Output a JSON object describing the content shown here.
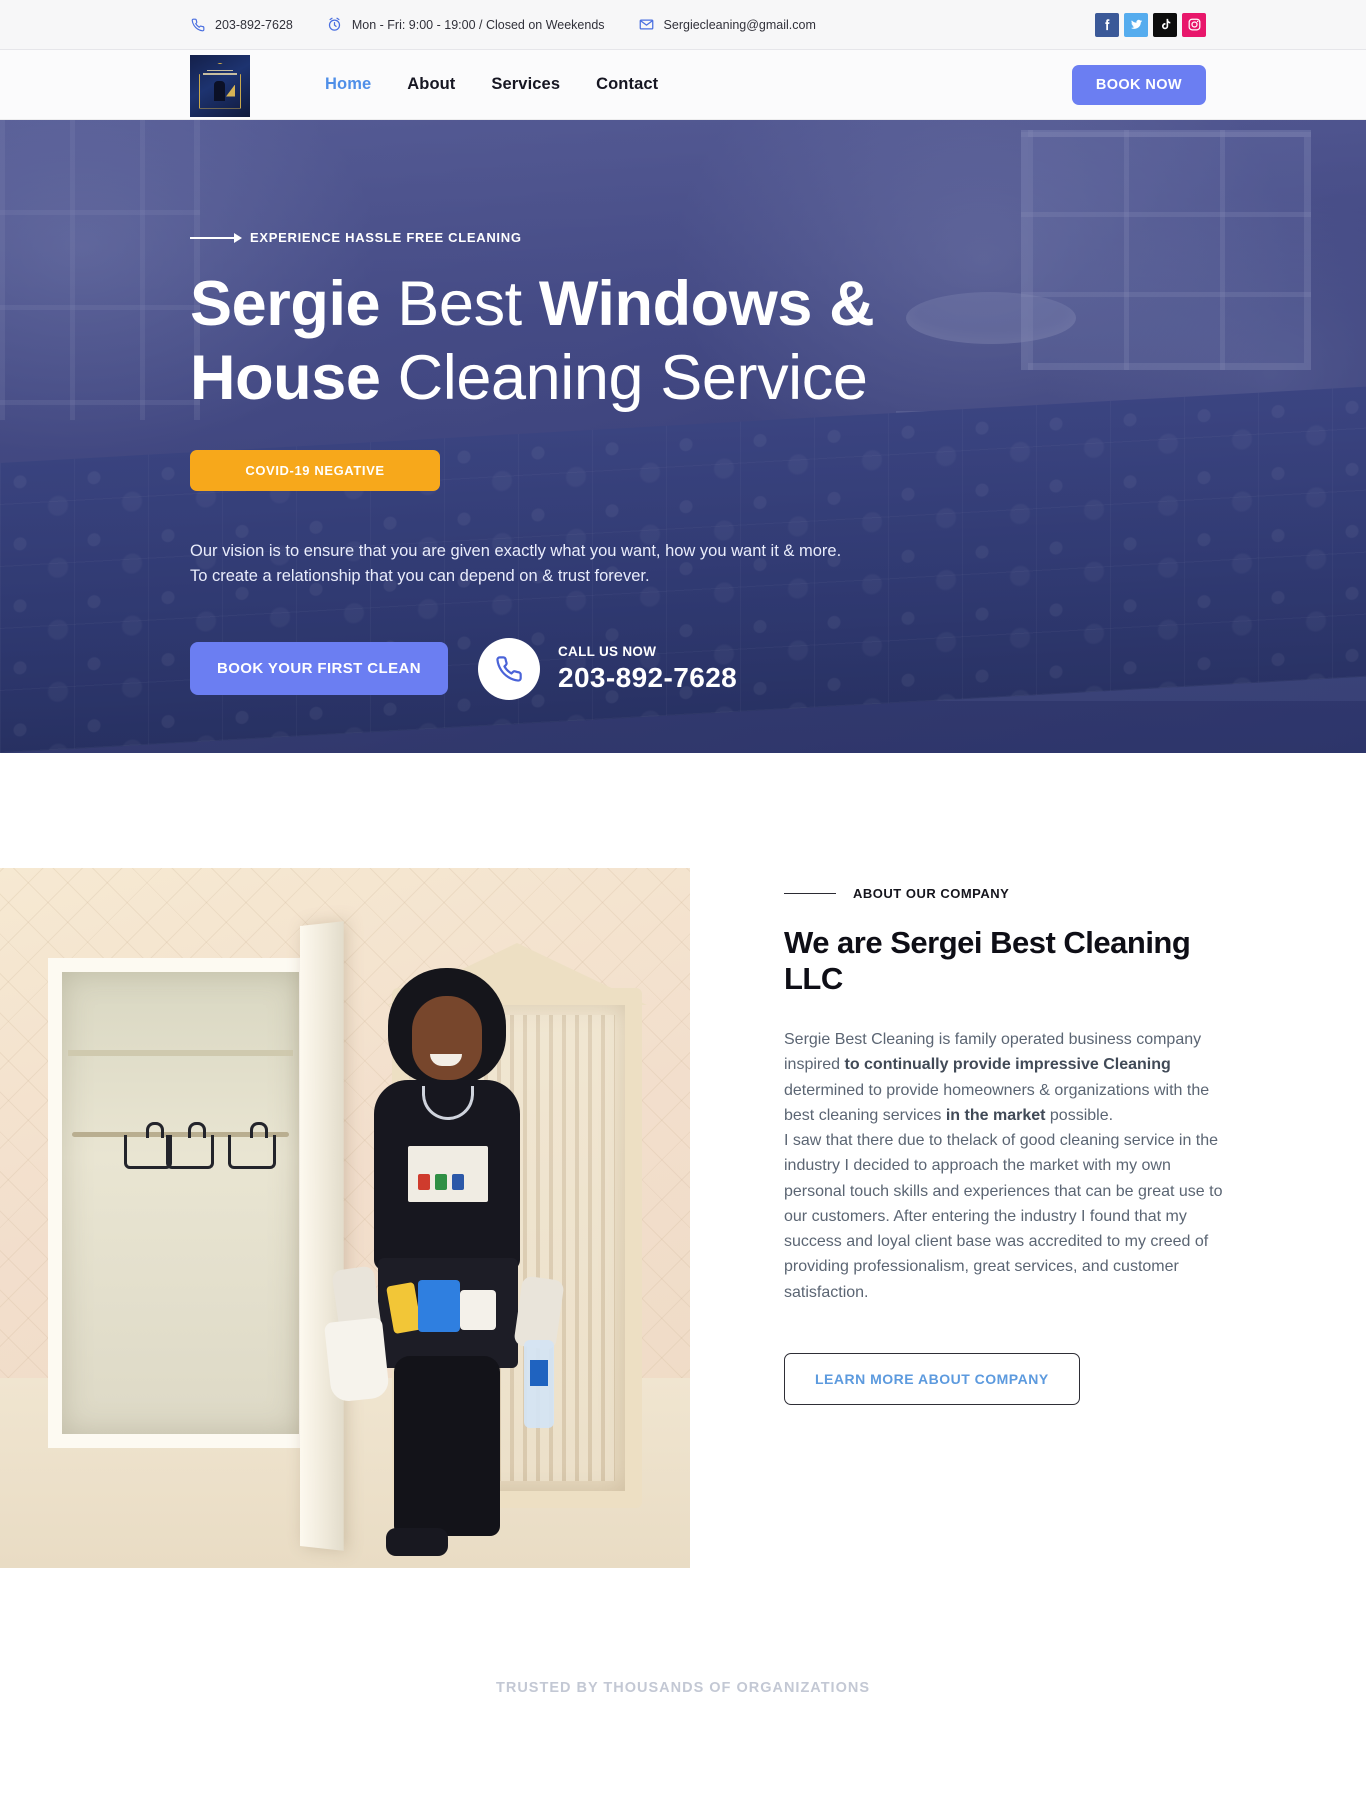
{
  "topbar": {
    "phone": "203-892-7628",
    "phone_icon": "phone-icon",
    "hours": "Mon - Fri: 9:00 - 19:00 / Closed on Weekends",
    "hours_icon": "clock-icon",
    "email": "Sergiecleaning@gmail.com",
    "email_icon": "envelope-icon",
    "socials": [
      {
        "name": "facebook-icon",
        "label": "Facebook",
        "color": "#3b5998"
      },
      {
        "name": "twitter-icon",
        "label": "Twitter",
        "color": "#55acee"
      },
      {
        "name": "tiktok-icon",
        "label": "TikTok",
        "color": "#0d0d0d"
      },
      {
        "name": "instagram-icon",
        "label": "Instagram",
        "color": "#e8176b"
      }
    ]
  },
  "nav": {
    "logo_alt": "Sergie Best Cleaning Service logo",
    "items": [
      {
        "label": "Home",
        "active": true
      },
      {
        "label": "About",
        "active": false
      },
      {
        "label": "Services",
        "active": false
      },
      {
        "label": "Contact",
        "active": false
      }
    ],
    "cta": "BOOK NOW",
    "cta_color": "#6b7ef2"
  },
  "hero": {
    "eyebrow": "EXPERIENCE HASSLE FREE CLEANING",
    "title_parts": [
      {
        "text": "Sergie",
        "bold": true
      },
      {
        "text": " Best ",
        "bold": false
      },
      {
        "text": "Windows &",
        "bold": true
      },
      {
        "text": " ",
        "bold": false
      },
      {
        "text": "House",
        "bold": true
      },
      {
        "text": " Cleaning Service",
        "bold": false
      }
    ],
    "badge": "COVID-19 NEGATIVE",
    "badge_color": "#f7a81b",
    "subtitle": "Our vision is to ensure that you are given exactly what you want, how you want it & more. To create a relationship that you can depend on & trust forever.",
    "cta": "BOOK YOUR FIRST CLEAN",
    "call_label": "CALL US NOW",
    "call_number": "203-892-7628",
    "call_icon": "phone-icon"
  },
  "about": {
    "image_alt": "Cleaner standing in a bedroom holding cloth and spray bottle",
    "eyebrow": "ABOUT OUR COMPANY",
    "title": "We are Sergei Best Cleaning LLC",
    "p1_a": "Sergie Best Cleaning is family operated business company inspired ",
    "p1_b": "to continually provide impressive Cleaning",
    "p1_c": " determined to provide homeowners & organizations with the best cleaning services ",
    "p1_d": "in the market",
    "p1_e": " possible.",
    "p2": "I saw that there due to thelack of good cleaning service in the industry I decided to approach the market with my own personal touch skills and experiences that can be great use to our customers. After entering the industry I found that my success and loyal client base was accredited to my creed of providing professionalism, great services, and customer satisfaction.",
    "cta": "LEARN MORE ABOUT COMPANY"
  },
  "trusted": {
    "text": "TRUSTED BY THOUSANDS OF ORGANIZATIONS"
  }
}
